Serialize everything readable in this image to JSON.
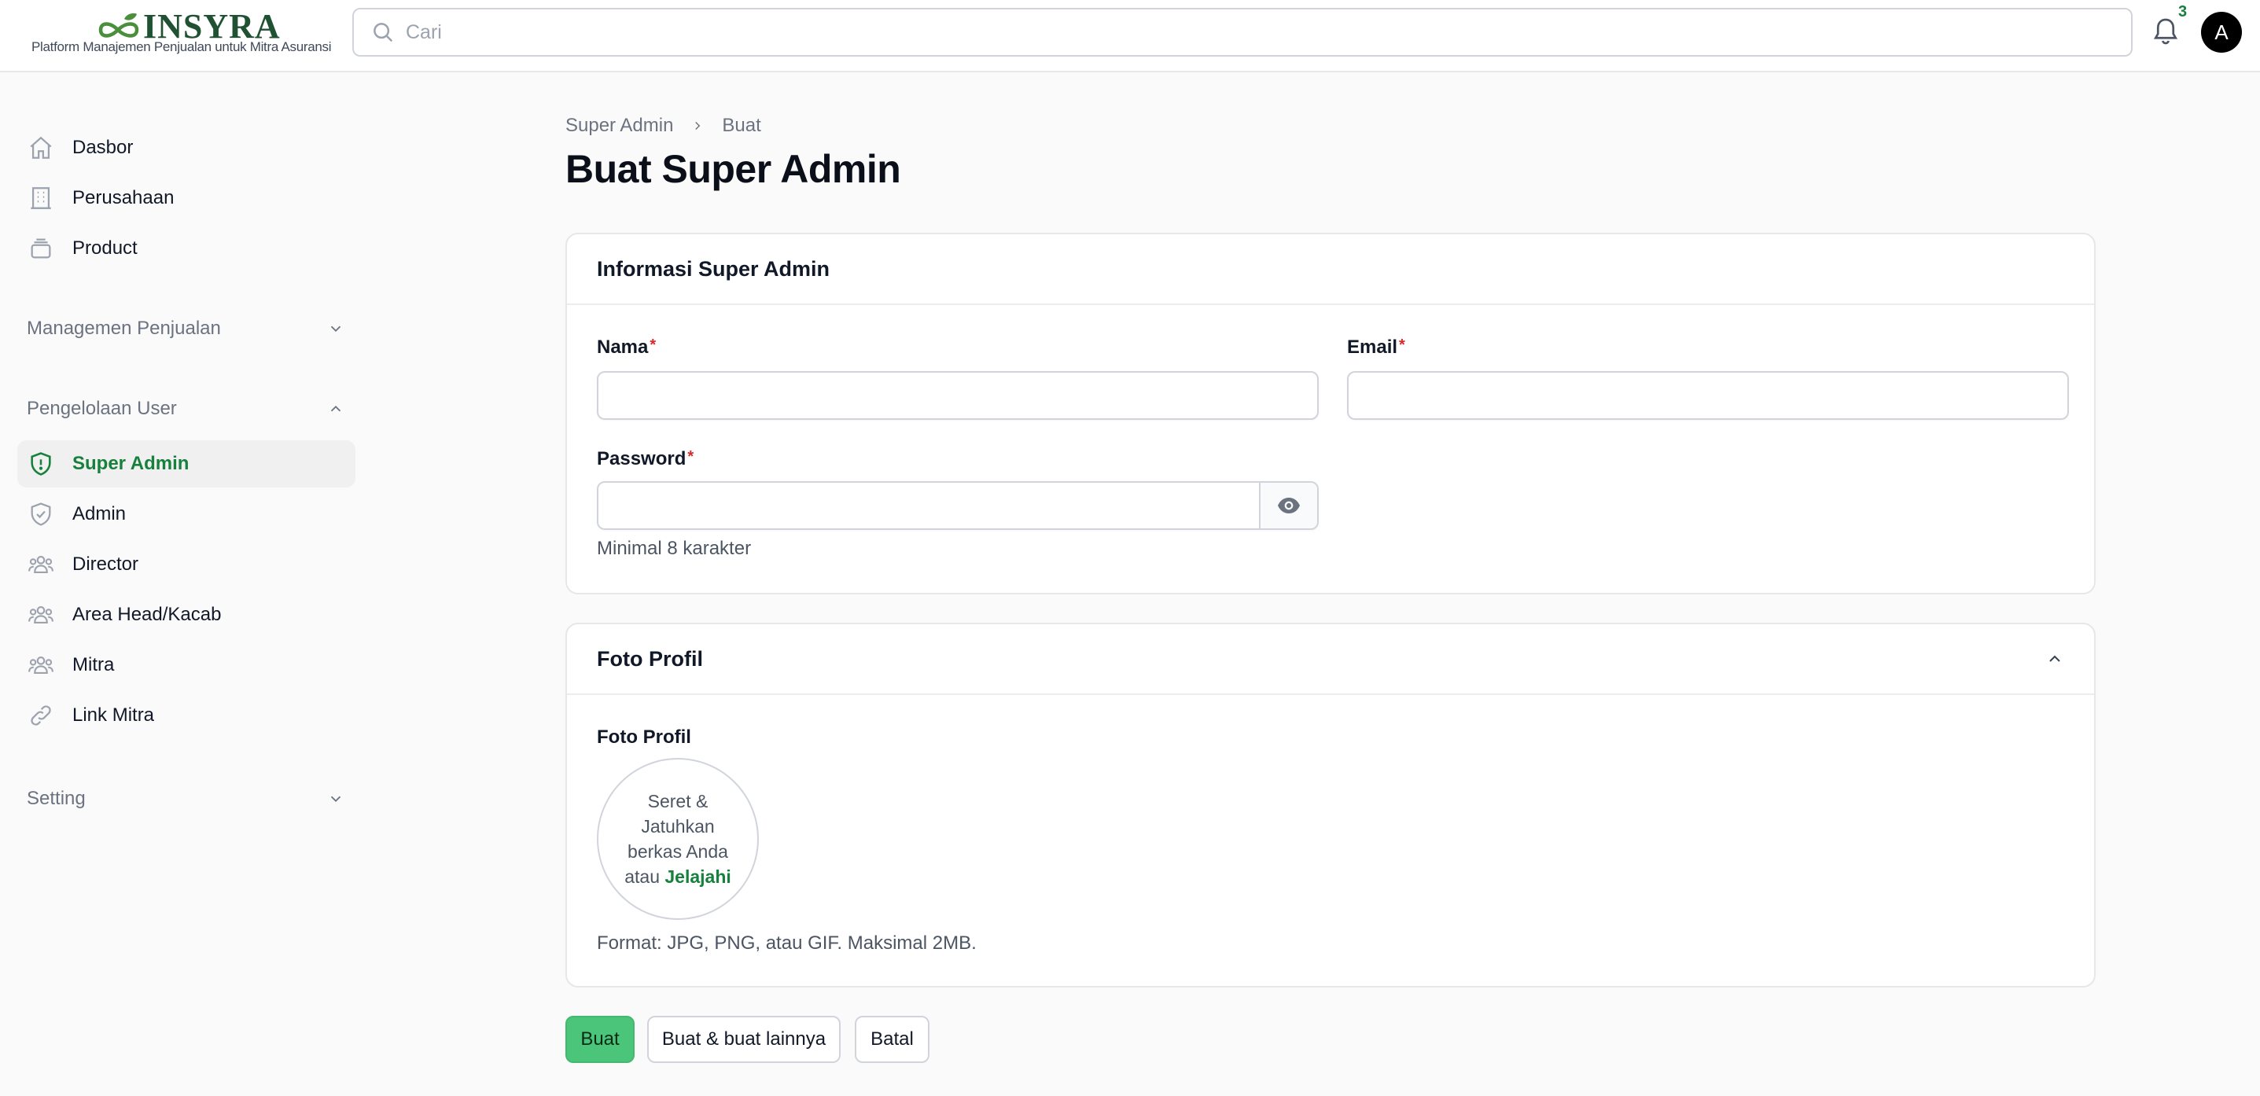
{
  "brand": {
    "name": "INSYRA",
    "tagline": "Platform Manajemen Penjualan untuk Mitra Asuransi",
    "color": "#1f5132"
  },
  "search": {
    "placeholder": "Cari"
  },
  "notifications": {
    "count": "3"
  },
  "user": {
    "avatar_initial": "A"
  },
  "sidebar": {
    "top_items": [
      {
        "label": "Dasbor",
        "icon": "home-icon"
      },
      {
        "label": "Perusahaan",
        "icon": "building-icon"
      },
      {
        "label": "Product",
        "icon": "archive-box-icon"
      }
    ],
    "groups": [
      {
        "label": "Managemen Penjualan",
        "expanded": false
      },
      {
        "label": "Pengelolaan User",
        "expanded": true
      },
      {
        "label": "Setting",
        "expanded": false
      }
    ],
    "user_items": [
      {
        "label": "Super Admin",
        "icon": "shield-exclamation-icon",
        "active": true
      },
      {
        "label": "Admin",
        "icon": "shield-check-icon",
        "active": false
      },
      {
        "label": "Director",
        "icon": "user-group-icon",
        "active": false
      },
      {
        "label": "Area Head/Kacab",
        "icon": "user-group-icon",
        "active": false
      },
      {
        "label": "Mitra",
        "icon": "user-group-icon",
        "active": false
      },
      {
        "label": "Link Mitra",
        "icon": "link-icon",
        "active": false
      }
    ]
  },
  "breadcrumb": {
    "parent": "Super Admin",
    "current": "Buat"
  },
  "page_title": "Buat Super Admin",
  "info_section": {
    "title": "Informasi Super Admin",
    "fields": {
      "nama": {
        "label": "Nama",
        "value": ""
      },
      "email": {
        "label": "Email",
        "value": ""
      },
      "password": {
        "label": "Password",
        "value": "",
        "helper": "Minimal 8 karakter"
      }
    }
  },
  "photo_section": {
    "title": "Foto Profil",
    "field_label": "Foto Profil",
    "dropzone_line1": "Seret &",
    "dropzone_line2": "Jatuhkan",
    "dropzone_line3": "berkas Anda",
    "dropzone_line4_prefix": "atau",
    "dropzone_link": "Jelajahi",
    "helper": "Format: JPG, PNG, atau GIF. Maksimal 2MB."
  },
  "actions": {
    "create": "Buat",
    "create_another": "Buat & buat lainnya",
    "cancel": "Batal"
  },
  "colors": {
    "accent": "#16803c",
    "primary_button": "#4ac57a",
    "required": "#dc2626"
  }
}
